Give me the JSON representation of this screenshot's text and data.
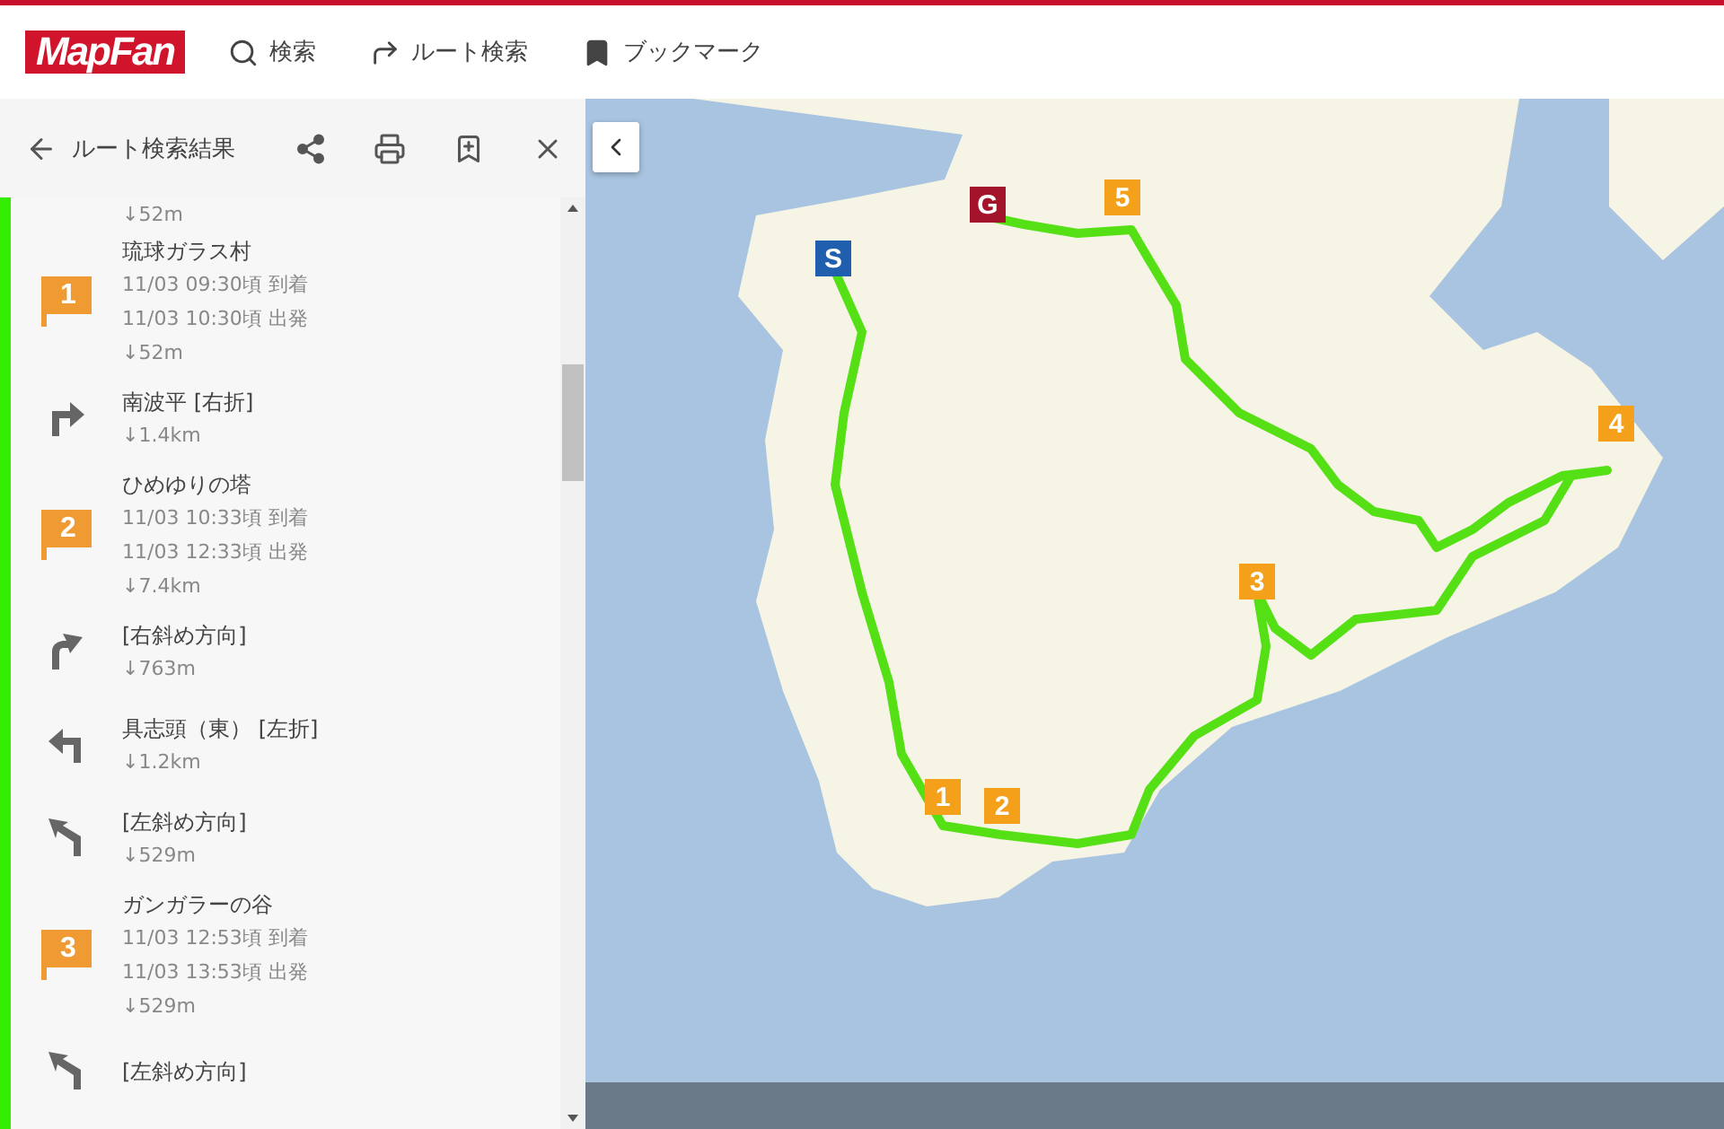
{
  "header": {
    "logo": "MapFan",
    "nav": [
      {
        "kind": "search",
        "label": "検索"
      },
      {
        "kind": "route",
        "label": "ルート検索"
      },
      {
        "kind": "bookmark",
        "label": "ブックマーク"
      }
    ]
  },
  "panel": {
    "title": "ルート検索結果"
  },
  "steps": [
    {
      "kind": "partial",
      "distance": "↓52m"
    },
    {
      "kind": "waypoint",
      "number": "1",
      "name": "琉球ガラス村",
      "arrive": "11/03 09:30頃 到着",
      "depart": "11/03 10:30頃 出発",
      "distance": "↓52m"
    },
    {
      "kind": "right",
      "name": "南波平 [右折]",
      "distance": "↓1.4km"
    },
    {
      "kind": "waypoint",
      "number": "2",
      "name": "ひめゆりの塔",
      "arrive": "11/03 10:33頃 到着",
      "depart": "11/03 12:33頃 出発",
      "distance": "↓7.4km"
    },
    {
      "kind": "bear-right",
      "name": "[右斜め方向]",
      "distance": "↓763m"
    },
    {
      "kind": "left",
      "name": "具志頭（東） [左折]",
      "distance": "↓1.2km"
    },
    {
      "kind": "bear-left",
      "name": "[左斜め方向]",
      "distance": "↓529m"
    },
    {
      "kind": "waypoint",
      "number": "3",
      "name": "ガンガラーの谷",
      "arrive": "11/03 12:53頃 到着",
      "depart": "11/03 13:53頃 出発",
      "distance": "↓529m"
    },
    {
      "kind": "bear-left",
      "name": "[左斜め方向]"
    }
  ],
  "map": {
    "markers": [
      {
        "kind": "start",
        "label": "S"
      },
      {
        "kind": "goal",
        "label": "G"
      },
      {
        "kind": "waypoint",
        "label": "5"
      },
      {
        "kind": "waypoint",
        "label": "4"
      },
      {
        "kind": "waypoint",
        "label": "3"
      },
      {
        "kind": "waypoint",
        "label": "1"
      },
      {
        "kind": "waypoint",
        "label": "2"
      }
    ]
  }
}
